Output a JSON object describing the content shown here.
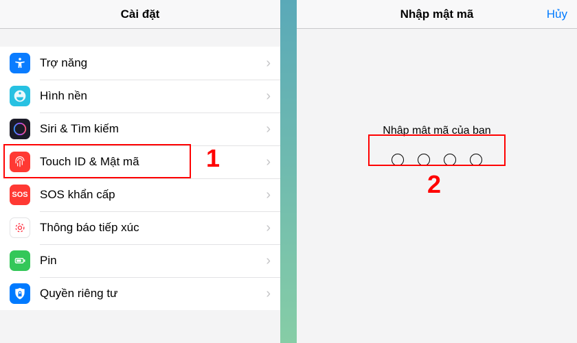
{
  "left": {
    "title": "Cài đặt",
    "rows": [
      {
        "label": "Trợ năng",
        "icon": "accessibility-icon"
      },
      {
        "label": "Hình nền",
        "icon": "wallpaper-icon"
      },
      {
        "label": "Siri & Tìm kiếm",
        "icon": "siri-icon"
      },
      {
        "label": "Touch ID & Mật mã",
        "icon": "touchid-icon"
      },
      {
        "label": "SOS khẩn cấp",
        "icon": "sos-icon",
        "text": "SOS"
      },
      {
        "label": "Thông báo tiếp xúc",
        "icon": "exposure-icon"
      },
      {
        "label": "Pin",
        "icon": "battery-icon"
      },
      {
        "label": "Quyền riêng tư",
        "icon": "privacy-icon"
      }
    ]
  },
  "right": {
    "title": "Nhập mật mã",
    "cancel": "Hủy",
    "prompt": "Nhập mật mã của bạn",
    "passcode_length": 4
  },
  "annotations": {
    "step1": "1",
    "step2": "2"
  }
}
